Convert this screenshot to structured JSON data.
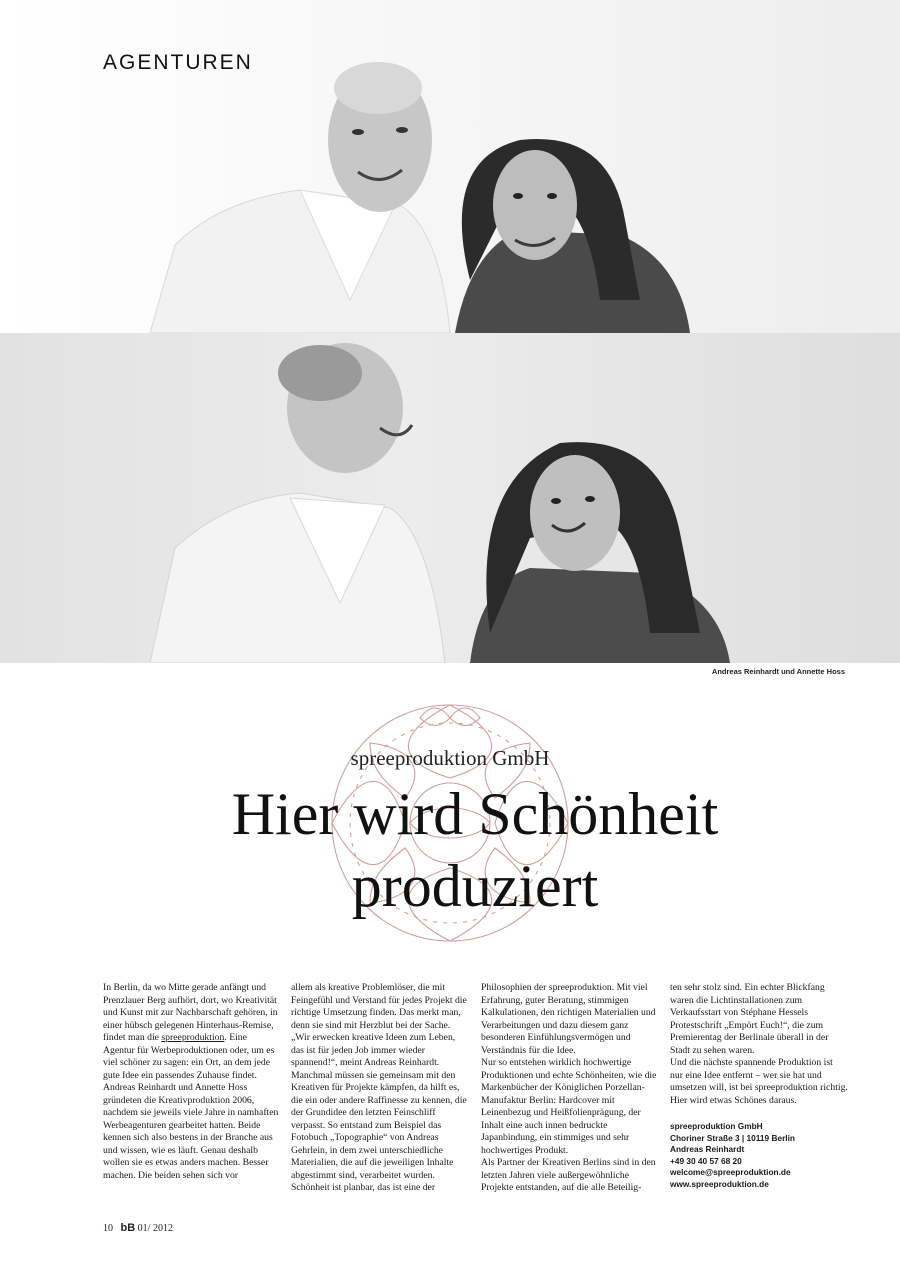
{
  "header": {
    "section": "AGENTUREN"
  },
  "photos": {
    "top_alt": "Andreas Reinhardt und Annette Hoss smiling",
    "bottom_alt": "Andreas Reinhardt und Annette Hoss laughing",
    "caption": "Andreas Reinhardt und Annette Hoss"
  },
  "article": {
    "kicker": "spreeproduktion GmbH",
    "headline_line1": "Hier wird Schönheit",
    "headline_line2": "produziert",
    "col1": {
      "p1_a": "In Berlin, da wo Mitte gerade anfängt und Prenzlauer Berg aufhört, dort, wo Kreativität und Kunst mit zur Nachbarschaft gehören, in einer hübsch gelegenen Hinterhaus-Remise, findet man die ",
      "p1_link": "spreeproduktion",
      "p1_b": ". Eine Agentur für Werbeproduktionen oder, um es viel schöner zu sagen: ein Ort, an dem jede gute Idee ein passendes Zuhause findet.",
      "p2": "Andreas Reinhardt und Annette Hoss gründeten die Kreativproduktion 2006, nachdem sie jeweils viele Jahre in namhaften Werbeagenturen gearbeitet hatten. Beide kennen sich also bestens in der Branche aus und wissen, wie es läuft. Genau deshalb wollen sie es etwas anders machen. Besser machen. Die beiden sehen sich vor"
    },
    "col2": {
      "p1": "allem als kreative Problemlöser, die mit Feingefühl und Verstand für jedes Projekt die richtige Umsetzung finden. Das merkt man, denn sie sind mit Herzblut bei der Sache. „Wir erwecken kreative Ideen zum Leben, das ist für jeden Job immer wieder spannend!“, meint Andreas Reinhardt. Manchmal müssen sie gemeinsam mit den Kreativen für Projekte kämpfen, da hilft es, die ein oder andere Raffinesse zu kennen, die der Grundidee den letzten Feinschliff verpasst. So entstand zum Beispiel das Fotobuch „Topographie“ von Andreas Gehrlein, in dem zwei unterschiedliche Materialien, die auf die jeweiligen Inhalte abgestimmt sind, verarbeitet wurden.",
      "p2": "Schönheit ist planbar, das ist eine der"
    },
    "col3": {
      "p1": "Philosophien der spreeproduktion. Mit viel Erfahrung, guter Beratung, stimmigen Kalkulationen, den richtigen Materialien und Verarbeitungen und dazu diesem ganz besonderen Einfühlungsvermögen und Verständnis für die Idee.",
      "p2": "Nur so entstehen wirklich hochwertige Produktionen und echte Schönheiten, wie die Markenbücher der Königlichen Porzellan-Manufaktur Berlin: Hardcover mit Leinenbezug und Heißfolienprägung, der Inhalt eine auch innen bedruckte Japanbindung, ein stimmiges und sehr hochwertiges Produkt.",
      "p3": "Als Partner der Kreativen Berlins sind in den letzten Jahren viele außergewöhnliche Projekte entstanden, auf die alle Beteilig-"
    },
    "col4": {
      "p1": "ten sehr stolz sind. Ein echter Blickfang waren die Lichtinstallationen zum Verkaufsstart von Stéphane Hessels Protestschrift „Empört Euch!“, die zum Premierentag der Berlinale überall in der Stadt zu sehen waren.",
      "p2": "Und die nächste spannende Produktion ist nur eine Idee entfernt – wer sie hat und umsetzen will, ist bei spreeproduktion richtig. Hier wird etwas Schönes daraus."
    },
    "contact": {
      "company": "spreeproduktion GmbH",
      "address": "Choriner Straße 3 | 10119 Berlin",
      "person": "Andreas Reinhardt",
      "phone": "+49 30 40 57 68 20",
      "email": "welcome@spreeproduktion.de",
      "web": "www.spreeproduktion.de"
    }
  },
  "footer": {
    "page": "10",
    "logo": "bB",
    "issue": "01/ 2012"
  },
  "colors": {
    "ornament": "#c98d8d",
    "rule": "#111111"
  }
}
